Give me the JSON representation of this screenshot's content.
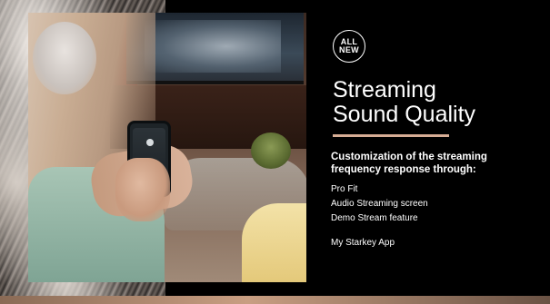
{
  "badge": {
    "line1": "ALL",
    "line2": "NEW"
  },
  "title": {
    "line1": "Streaming",
    "line2": "Sound Quality"
  },
  "subheading": {
    "line1": "Customization of the streaming",
    "line2": "frequency response through:"
  },
  "features": [
    "Pro Fit",
    "Audio Streaming screen",
    "Demo Stream feature"
  ],
  "app_name": "My Starkey App",
  "colors": {
    "background": "#000000",
    "accent": "#d7ad95",
    "text": "#ffffff"
  }
}
